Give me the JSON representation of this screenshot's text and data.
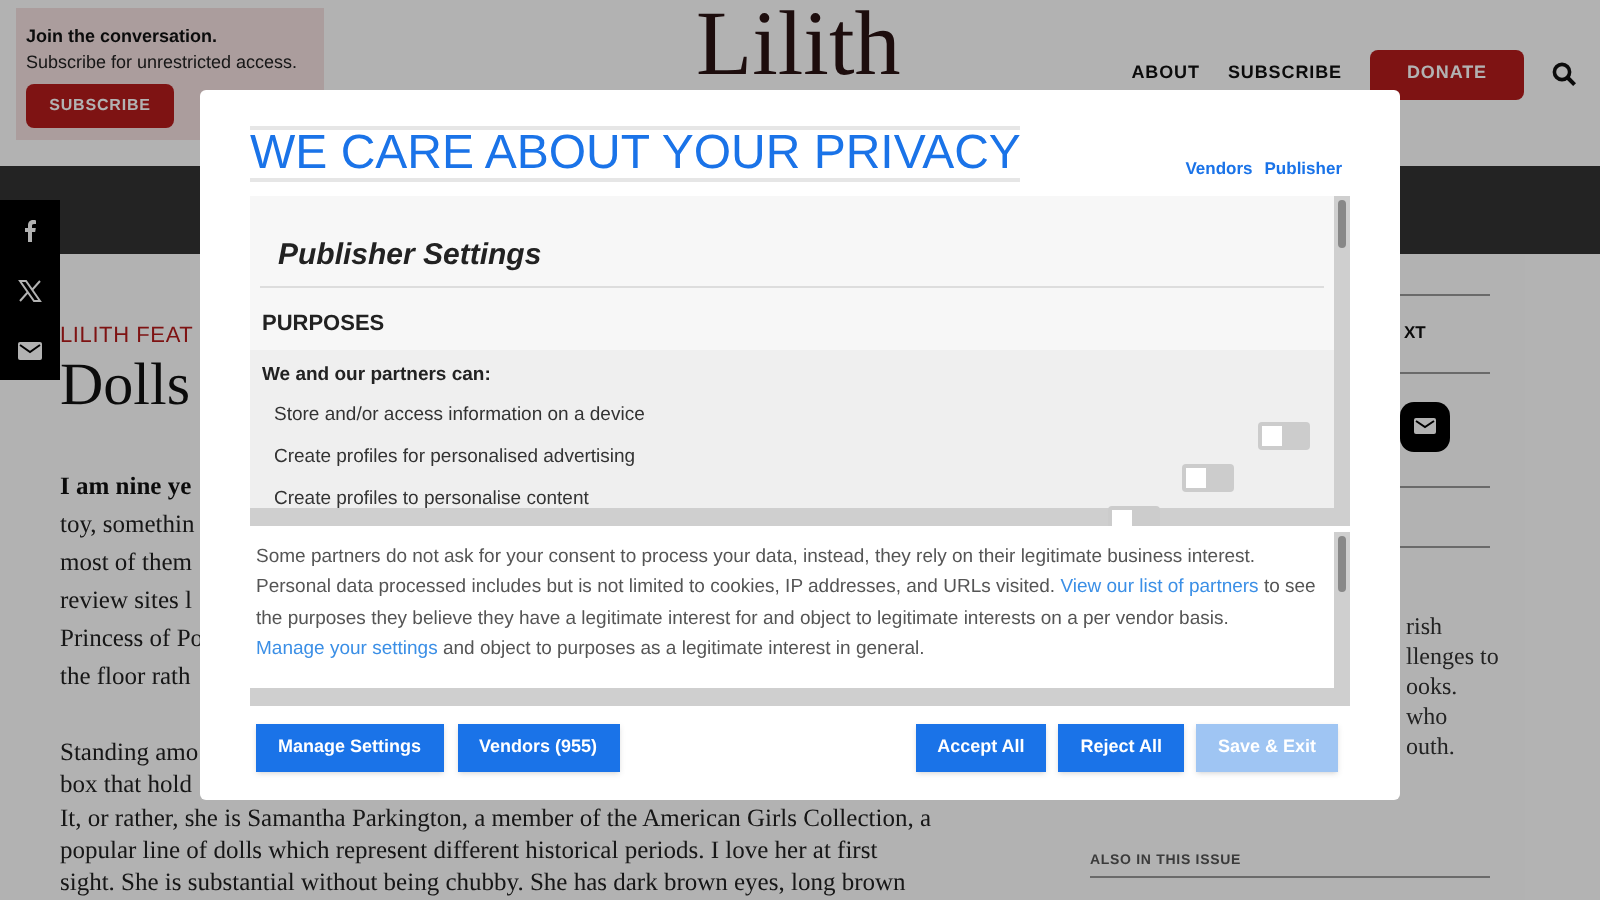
{
  "promo": {
    "heading": "Join the conversation.",
    "text": "Subscribe for unrestricted access.",
    "button": "SUBSCRIBE"
  },
  "logo": "Lilith",
  "nav": [
    {
      "label": "ABOUT",
      "kind": "link"
    },
    {
      "label": "SUBSCRIBE",
      "kind": "link"
    },
    {
      "label": "DONATE",
      "kind": "button"
    }
  ],
  "article": {
    "kicker": "LILITH FEAT",
    "title": "Dolls",
    "paragraphs": [
      {
        "lead": true,
        "lines": [
          "I am nine ye",
          "toy, somethin",
          "most of them",
          "review sites l",
          "Princess of Po",
          "the floor rath"
        ]
      },
      {
        "lead": false,
        "lines": [
          "Standing amo",
          "box that hold",
          "It, or rather, she is Samantha Parkington, a member of the American Girls Collection, a",
          "popular line of dolls which represent different historical periods. I love her at first",
          "sight. She is substantial without being chubby. She has dark brown eyes, long brown"
        ]
      }
    ]
  },
  "sidebar": {
    "heading": "XT",
    "lines": [
      "rish",
      "llenges to",
      "ooks.",
      "who",
      "outh."
    ],
    "section": "ALSO IN THIS ISSUE"
  },
  "consent": {
    "title": "WE CARE ABOUT YOUR PRIVACY",
    "tabs": [
      "Vendors",
      "Publisher"
    ],
    "settings_title": "Publisher Settings",
    "purposes_heading": "PURPOSES",
    "intro": "We and our partners can:",
    "purposes": [
      {
        "label": "Store and/or access information on a device",
        "on": false
      },
      {
        "label": "Create profiles for personalised advertising",
        "on": false
      },
      {
        "label": "Create profiles to personalise content",
        "on": false
      }
    ],
    "notice": [
      {
        "kind": "text",
        "text": "Some partners do not ask for your consent to process your data, instead, they rely on their legitimate business interest. Personal data processed includes but is not limited to cookies, IP addresses, and URLs visited. "
      },
      {
        "kind": "link",
        "text": "View our list of partners"
      },
      {
        "kind": "text",
        "text": " to see the purposes they believe they have a legitimate interest for and object to legitimate interests on a per vendor basis. "
      },
      {
        "kind": "link",
        "text": "Manage your settings"
      },
      {
        "kind": "text",
        "text": " and object to purposes as a legitimate interest in general."
      }
    ],
    "left_buttons": [
      {
        "label": "Manage Settings",
        "disabled": false
      },
      {
        "label": "Vendors (955)",
        "disabled": false
      }
    ],
    "right_buttons": [
      {
        "label": "Accept All",
        "disabled": false
      },
      {
        "label": "Reject All",
        "disabled": false
      },
      {
        "label": "Save & Exit",
        "disabled": true
      }
    ]
  }
}
